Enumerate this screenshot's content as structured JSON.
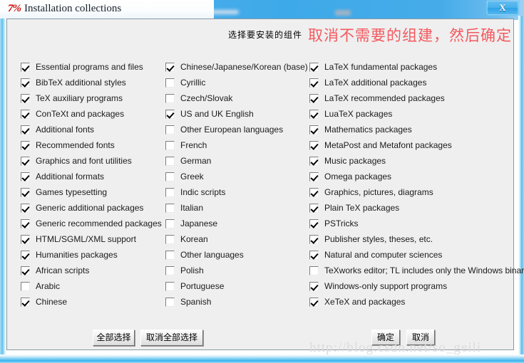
{
  "window": {
    "title": "Installation collections",
    "icon": "tex-logo-icon",
    "logo_text": "7%",
    "close_label": "X"
  },
  "header": {
    "note": "选择要安装的组件",
    "warning": "取消不需要的组建，然后确定"
  },
  "columns": [
    {
      "name": "schemes-column",
      "items": [
        {
          "label": "Essential programs and files",
          "checked": true
        },
        {
          "label": "BibTeX additional styles",
          "checked": true
        },
        {
          "label": "TeX auxiliary programs",
          "checked": true
        },
        {
          "label": "ConTeXt and packages",
          "checked": true
        },
        {
          "label": "Additional fonts",
          "checked": true
        },
        {
          "label": "Recommended fonts",
          "checked": true
        },
        {
          "label": "Graphics and font utilities",
          "checked": true
        },
        {
          "label": "Additional formats",
          "checked": true
        },
        {
          "label": "Games typesetting",
          "checked": true
        },
        {
          "label": "Generic additional packages",
          "checked": true
        },
        {
          "label": "Generic recommended packages",
          "checked": true
        },
        {
          "label": "HTML/SGML/XML support",
          "checked": true
        },
        {
          "label": "Humanities packages",
          "checked": true
        },
        {
          "label": "African scripts",
          "checked": true
        },
        {
          "label": "Arabic",
          "checked": false
        },
        {
          "label": "Chinese",
          "checked": true
        }
      ]
    },
    {
      "name": "languages-column",
      "items": [
        {
          "label": "Chinese/Japanese/Korean (base)",
          "checked": true
        },
        {
          "label": "Cyrillic",
          "checked": false
        },
        {
          "label": "Czech/Slovak",
          "checked": false
        },
        {
          "label": "US and UK English",
          "checked": true
        },
        {
          "label": "Other European languages",
          "checked": false
        },
        {
          "label": "French",
          "checked": false
        },
        {
          "label": "German",
          "checked": false
        },
        {
          "label": "Greek",
          "checked": false
        },
        {
          "label": "Indic scripts",
          "checked": false
        },
        {
          "label": "Italian",
          "checked": false
        },
        {
          "label": "Japanese",
          "checked": false
        },
        {
          "label": "Korean",
          "checked": false
        },
        {
          "label": "Other languages",
          "checked": false
        },
        {
          "label": "Polish",
          "checked": false
        },
        {
          "label": "Portuguese",
          "checked": false
        },
        {
          "label": "Spanish",
          "checked": false
        }
      ]
    },
    {
      "name": "packages-column",
      "items": [
        {
          "label": "LaTeX fundamental packages",
          "checked": true
        },
        {
          "label": "LaTeX additional packages",
          "checked": true
        },
        {
          "label": "LaTeX recommended packages",
          "checked": true
        },
        {
          "label": "LuaTeX packages",
          "checked": true
        },
        {
          "label": "Mathematics packages",
          "checked": true
        },
        {
          "label": "MetaPost and Metafont packages",
          "checked": true
        },
        {
          "label": "Music packages",
          "checked": true
        },
        {
          "label": "Omega packages",
          "checked": true
        },
        {
          "label": "Graphics, pictures, diagrams",
          "checked": true
        },
        {
          "label": "Plain TeX packages",
          "checked": true
        },
        {
          "label": "PSTricks",
          "checked": true
        },
        {
          "label": "Publisher styles, theses, etc.",
          "checked": true
        },
        {
          "label": "Natural and computer sciences",
          "checked": true
        },
        {
          "label": "TeXworks editor; TL includes only the Windows binary",
          "checked": false
        },
        {
          "label": "Windows-only support programs",
          "checked": true
        },
        {
          "label": "XeTeX and packages",
          "checked": true
        }
      ]
    }
  ],
  "buttons": {
    "select_all": "全部选择",
    "deselect_all": "取消全部选择",
    "ok": "确定",
    "cancel": "取消"
  },
  "watermark": "http://blog.csdn.net/so_geili",
  "colors": {
    "dialog_bg": "#efefef",
    "titlebar_blue": "#3ea9e9",
    "warning_red": "#f4595f",
    "logo_red": "#cc0000",
    "watermark_gray": "#dcdcdc"
  }
}
